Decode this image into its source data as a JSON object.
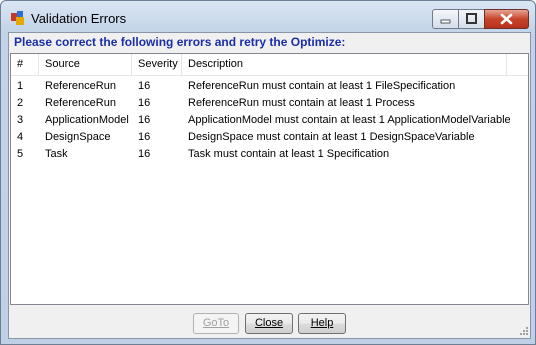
{
  "window": {
    "title": "Validation Errors"
  },
  "banner": "Please correct the following errors and retry the Optimize:",
  "columns": [
    "#",
    "Source",
    "Severity",
    "Description"
  ],
  "rows": [
    {
      "num": "1",
      "source": "ReferenceRun",
      "severity": "16",
      "description": "ReferenceRun must contain at least 1 FileSpecification"
    },
    {
      "num": "2",
      "source": "ReferenceRun",
      "severity": "16",
      "description": "ReferenceRun must contain at least 1 Process"
    },
    {
      "num": "3",
      "source": "ApplicationModel",
      "severity": "16",
      "description": "ApplicationModel must contain at least 1 ApplicationModelVariable"
    },
    {
      "num": "4",
      "source": "DesignSpace",
      "severity": "16",
      "description": "DesignSpace must contain at least 1 DesignSpaceVariable"
    },
    {
      "num": "5",
      "source": "Task",
      "severity": "16",
      "description": "Task must contain at least 1 Specification"
    }
  ],
  "buttons": {
    "goto": "GoTo",
    "close": "Close",
    "help": "Help"
  },
  "icons": {
    "app": "app-icon",
    "minimize": "minimize-icon",
    "maximize": "maximize-icon",
    "close": "close-icon",
    "grip": "resize-grip-icon"
  },
  "colors": {
    "banner": "#1a2ea8",
    "close_button": "#c7442b"
  }
}
